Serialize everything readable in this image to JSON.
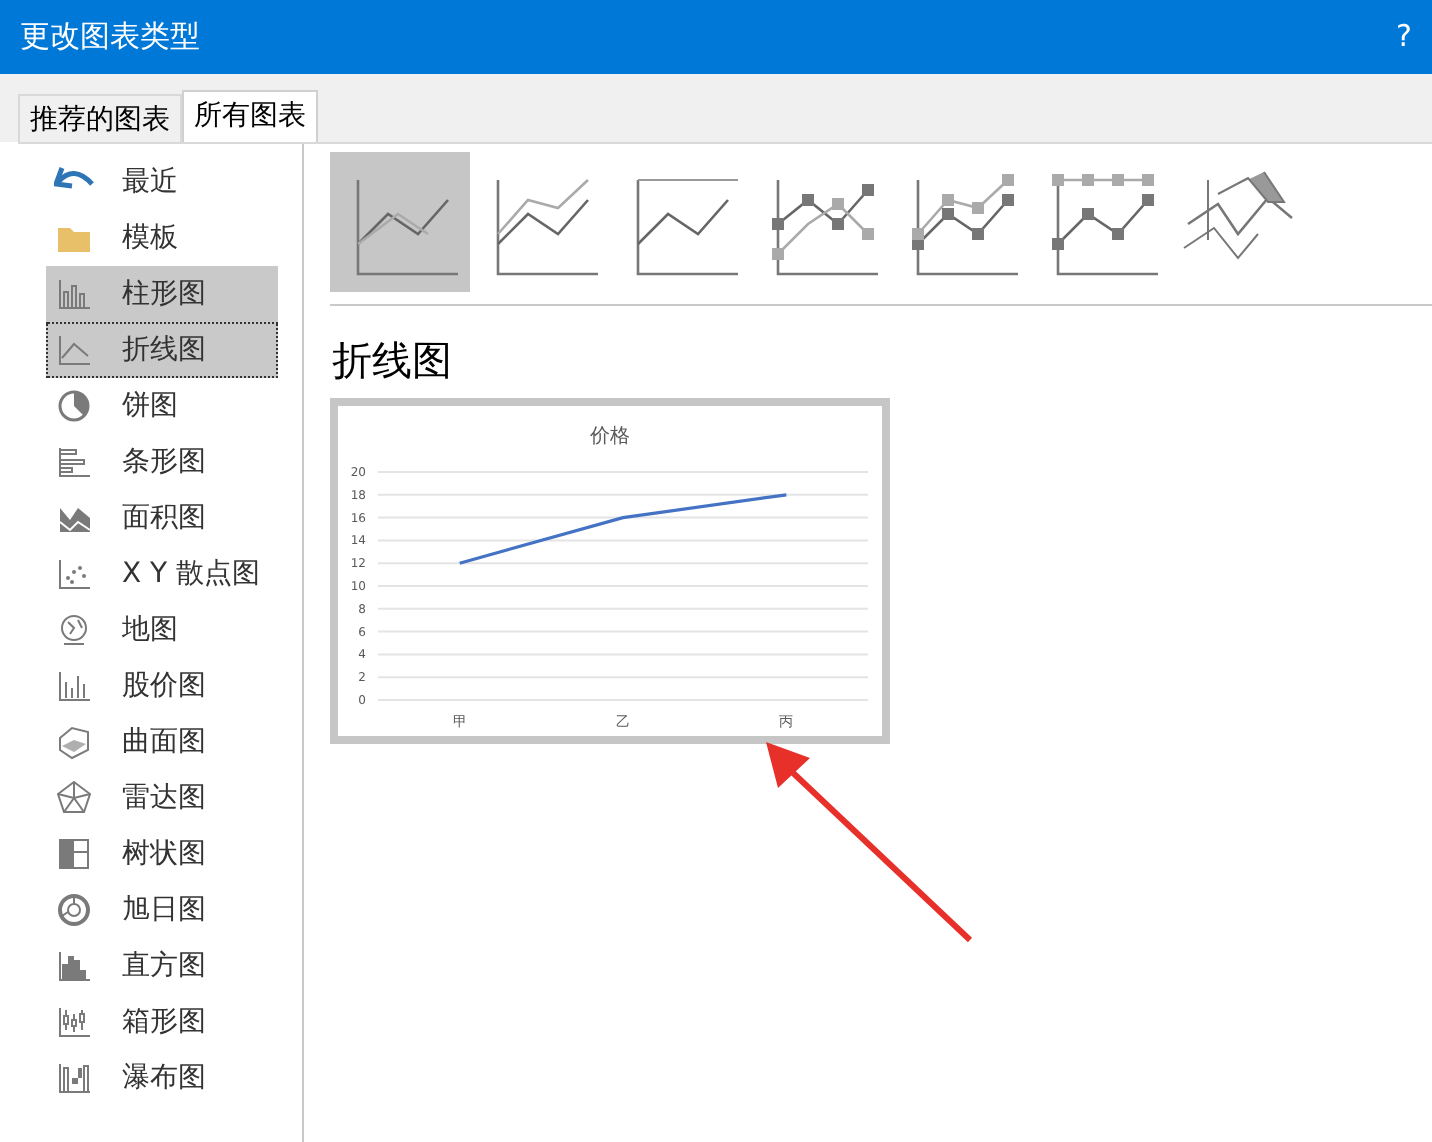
{
  "window": {
    "title": "更改图表类型",
    "help": "?"
  },
  "tabs": [
    {
      "label": "推荐的图表",
      "selected": false
    },
    {
      "label": "所有图表",
      "selected": true
    }
  ],
  "sidebar": {
    "items": [
      {
        "kind": "recent",
        "label": "最近",
        "selected": false,
        "highlighted": false
      },
      {
        "kind": "folder",
        "label": "模板",
        "selected": false,
        "highlighted": false
      },
      {
        "kind": "column",
        "label": "柱形图",
        "selected": false,
        "highlighted": true
      },
      {
        "kind": "line",
        "label": "折线图",
        "selected": true,
        "highlighted": true
      },
      {
        "kind": "pie",
        "label": "饼图",
        "selected": false,
        "highlighted": false
      },
      {
        "kind": "bar",
        "label": "条形图",
        "selected": false,
        "highlighted": false
      },
      {
        "kind": "area",
        "label": "面积图",
        "selected": false,
        "highlighted": false
      },
      {
        "kind": "scatter",
        "label": "X Y 散点图",
        "selected": false,
        "highlighted": false
      },
      {
        "kind": "map",
        "label": "地图",
        "selected": false,
        "highlighted": false
      },
      {
        "kind": "stock",
        "label": "股价图",
        "selected": false,
        "highlighted": false
      },
      {
        "kind": "surface",
        "label": "曲面图",
        "selected": false,
        "highlighted": false
      },
      {
        "kind": "radar",
        "label": "雷达图",
        "selected": false,
        "highlighted": false
      },
      {
        "kind": "treemap",
        "label": "树状图",
        "selected": false,
        "highlighted": false
      },
      {
        "kind": "sunburst",
        "label": "旭日图",
        "selected": false,
        "highlighted": false
      },
      {
        "kind": "histogram",
        "label": "直方图",
        "selected": false,
        "highlighted": false
      },
      {
        "kind": "box",
        "label": "箱形图",
        "selected": false,
        "highlighted": false
      },
      {
        "kind": "waterfall",
        "label": "瀑布图",
        "selected": false,
        "highlighted": false
      }
    ]
  },
  "subtypes": [
    {
      "kind": "line",
      "selected": true
    },
    {
      "kind": "stacked",
      "selected": false
    },
    {
      "kind": "percent",
      "selected": false
    },
    {
      "kind": "markers",
      "selected": false
    },
    {
      "kind": "stacked-markers",
      "selected": false
    },
    {
      "kind": "percent-markers",
      "selected": false
    },
    {
      "kind": "threed",
      "selected": false
    }
  ],
  "heading": "折线图",
  "preview": {
    "chart_data": {
      "type": "line",
      "title": "价格",
      "categories": [
        "甲",
        "乙",
        "丙"
      ],
      "series": [
        {
          "color": "#4472c4",
          "values": [
            12,
            16,
            18
          ]
        }
      ],
      "grid": true,
      "ylim": [
        0,
        20
      ],
      "yticks": [
        0,
        2,
        4,
        6,
        8,
        10,
        12,
        14,
        16,
        18,
        20
      ]
    }
  }
}
